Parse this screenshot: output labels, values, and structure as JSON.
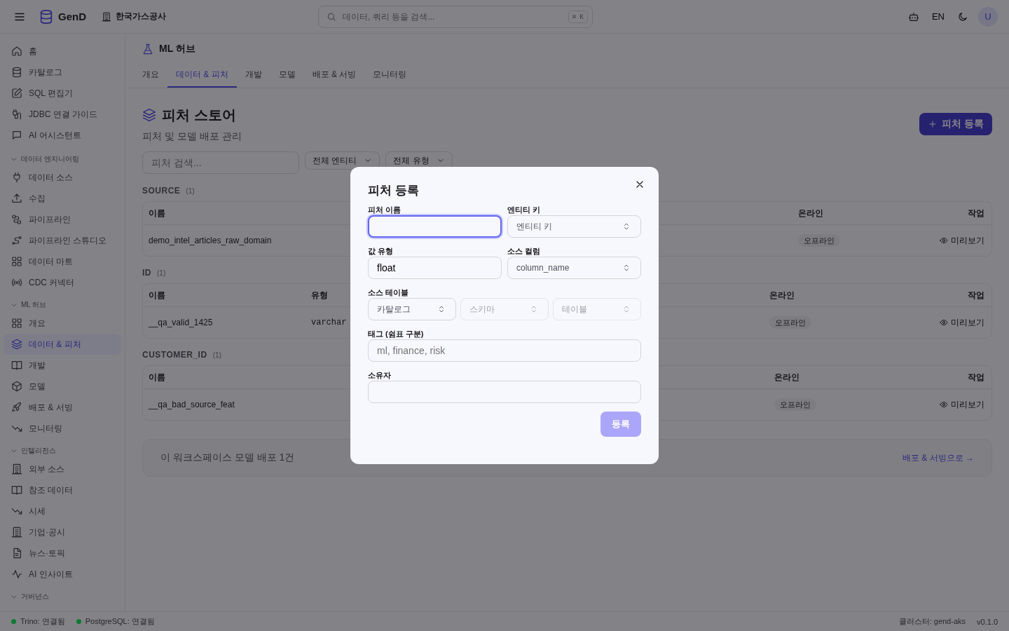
{
  "header": {
    "brand": "GenD",
    "org": "한국가스공사",
    "search": {
      "placeholder": "데이터, 쿼리 등을 검색...",
      "shortcut": "⌘ K"
    },
    "language": "EN",
    "avatar": "U"
  },
  "sidebar": {
    "items": [
      {
        "label": "홈",
        "selected": false
      },
      {
        "label": "카탈로그",
        "selected": false
      },
      {
        "label": "SQL 편집기",
        "selected": false
      },
      {
        "label": "JDBC 연결 가이드",
        "selected": false
      },
      {
        "label": "AI 어시스턴트",
        "selected": false
      }
    ],
    "groups": [
      {
        "title": "데이터 엔지니어링",
        "expanded": true,
        "items": [
          {
            "label": "데이터 소스",
            "selected": false
          },
          {
            "label": "수집",
            "selected": false
          },
          {
            "label": "파이프라인",
            "selected": false
          },
          {
            "label": "파이프라인 스튜디오",
            "selected": false
          },
          {
            "label": "데이터 마트",
            "selected": false
          },
          {
            "label": "CDC 커넥터",
            "selected": false
          }
        ]
      },
      {
        "title": "ML 허브",
        "expanded": true,
        "items": [
          {
            "label": "개요",
            "selected": false
          },
          {
            "label": "데이터 & 피처",
            "selected": true
          },
          {
            "label": "개발",
            "selected": false
          },
          {
            "label": "모델",
            "selected": false
          },
          {
            "label": "배포 & 서빙",
            "selected": false
          },
          {
            "label": "모니터링",
            "selected": false
          }
        ]
      },
      {
        "title": "인텔리전스",
        "expanded": true,
        "items": [
          {
            "label": "외부 소스",
            "selected": false
          },
          {
            "label": "참조 데이터",
            "selected": false
          },
          {
            "label": "시세",
            "selected": false
          },
          {
            "label": "기업·공시",
            "selected": false
          },
          {
            "label": "뉴스·토픽",
            "selected": false
          },
          {
            "label": "AI 인사이트",
            "selected": false
          }
        ]
      },
      {
        "title": "거버넌스",
        "expanded": true
      }
    ]
  },
  "page": {
    "section": "ML 허브",
    "tabs": [
      {
        "label": "개요",
        "selected": false
      },
      {
        "label": "데이터 & 피처",
        "selected": true
      },
      {
        "label": "개발",
        "selected": false
      },
      {
        "label": "모델",
        "selected": false
      },
      {
        "label": "배포 & 서빙",
        "selected": false
      },
      {
        "label": "모니터링",
        "selected": false
      }
    ],
    "title": "피처 스토어",
    "subtitle": "피처 및 모델 배포 관리",
    "add_button": "피처 등록",
    "search": {
      "placeholder": "피처 검색..."
    },
    "filters": [
      "전체 엔티티",
      "전체 유형"
    ],
    "groups": [
      {
        "title": "SOURCE",
        "count": "(1)",
        "columns": [
          {
            "label": "이름",
            "kind": "text"
          },
          {
            "label": "온라인",
            "kind": "badge"
          },
          {
            "label": "작업",
            "kind": "action"
          }
        ],
        "rows": [
          {
            "cells": [
              "demo_intel_articles_raw_domain",
              "오프라인",
              "미리보기"
            ]
          }
        ]
      },
      {
        "title": "ID",
        "count": "(1)",
        "columns": [
          {
            "label": "이름",
            "kind": "text"
          },
          {
            "label": "유형",
            "kind": "mono"
          },
          {
            "label": "온라인",
            "kind": "badge"
          },
          {
            "label": "작업",
            "kind": "action"
          }
        ],
        "rows": [
          {
            "cells": [
              "__qa_valid_1425",
              "varchar",
              "오프라인",
              "미리보기"
            ]
          }
        ]
      },
      {
        "title": "CUSTOMER_ID",
        "count": "(1)",
        "columns": [
          {
            "label": "이름",
            "kind": "text"
          },
          {
            "label": "온라인",
            "kind": "badge"
          },
          {
            "label": "작업",
            "kind": "action"
          }
        ],
        "rows": [
          {
            "cells": [
              "__qa_bad_source_feat",
              "오프라인",
              "미리보기"
            ]
          }
        ]
      }
    ],
    "summary": {
      "text": "이 워크스페이스 모델 배포 1건",
      "link": "배포 & 서빙으로 →"
    }
  },
  "modal": {
    "title": "피처 등록",
    "rows": [
      [
        {
          "kind": "input",
          "label": "피처 이름",
          "focused": true
        },
        {
          "kind": "select",
          "label": "엔티티 키",
          "placeholder": "엔티티 키",
          "disabled": false
        }
      ],
      [
        {
          "kind": "input",
          "label": "값 유형",
          "value": "float",
          "focused": false
        },
        {
          "kind": "select",
          "label": "소스 컬럼",
          "placeholder": "column_name",
          "disabled": false
        }
      ],
      [
        {
          "kind": "select_group",
          "label": "소스 테이블",
          "selects": [
            {
              "placeholder": "카탈로그",
              "disabled": false
            },
            {
              "placeholder": "스키마",
              "disabled": true
            },
            {
              "placeholder": "테이블",
              "disabled": true
            }
          ]
        }
      ],
      [
        {
          "kind": "input",
          "label": "태그 (쉼표 구분)",
          "placeholder": "ml, finance, risk",
          "focused": false
        }
      ],
      [
        {
          "kind": "input",
          "label": "소유자",
          "focused": false
        }
      ]
    ],
    "submit": {
      "label": "등록",
      "disabled": true
    }
  },
  "status_bar": {
    "statuses": [
      {
        "label": "Trino: 연결됨",
        "color": "#0f7a32"
      },
      {
        "label": "PostgreSQL: 연결됨",
        "color": "#0f7a32"
      }
    ],
    "cluster": "클러스터: gend-aks",
    "version": "v0.1.0"
  }
}
